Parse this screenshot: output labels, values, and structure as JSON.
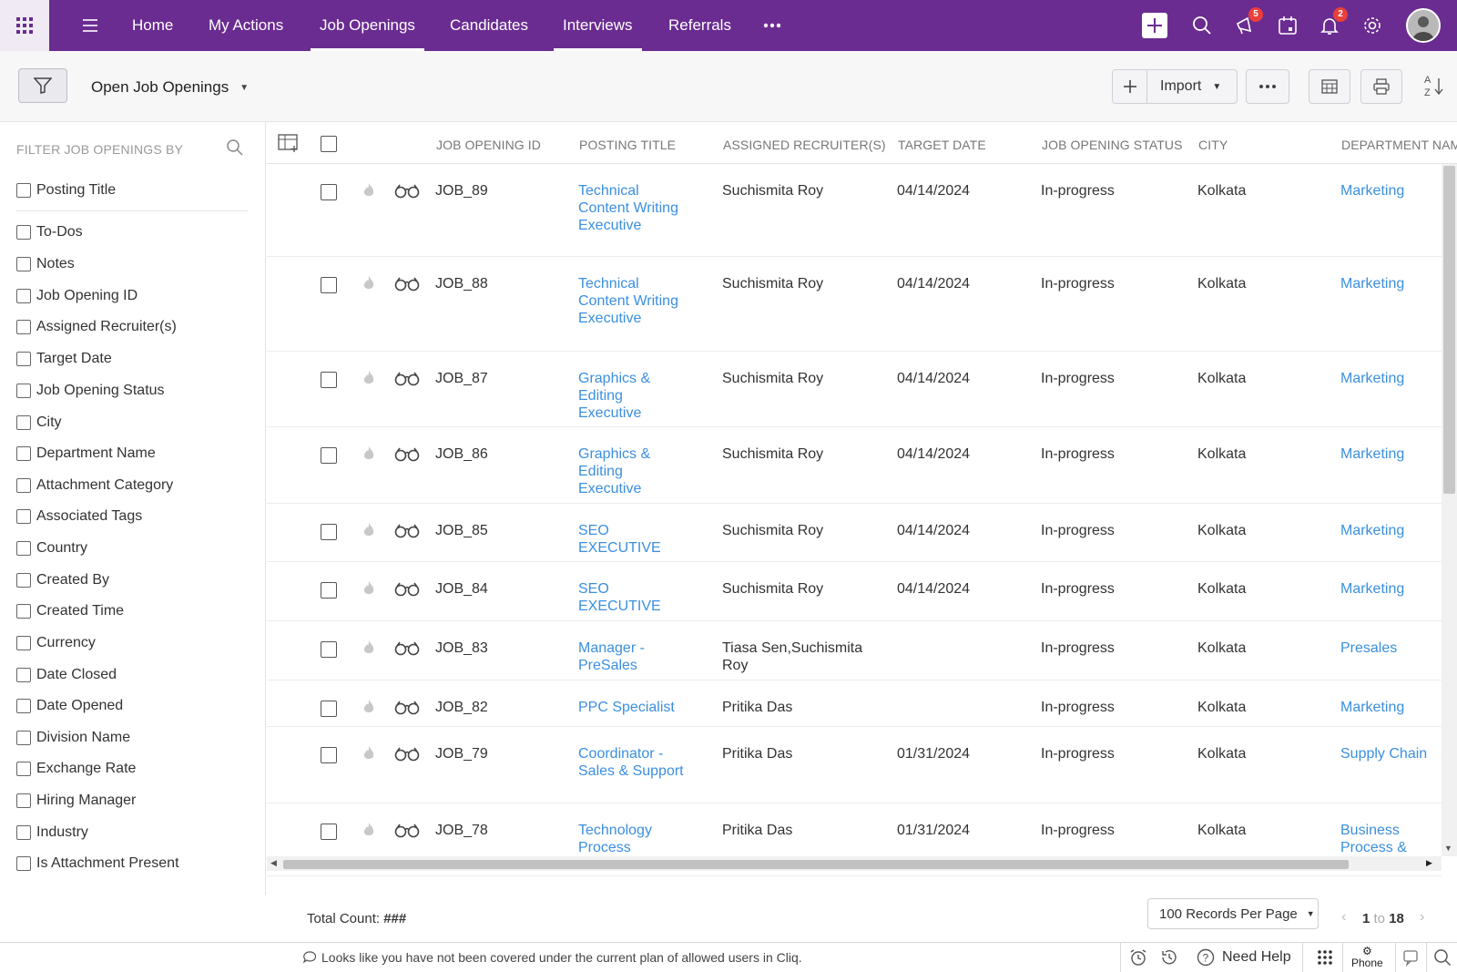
{
  "topnav": {
    "items": [
      "Home",
      "My Actions",
      "Job Openings",
      "Candidates",
      "Interviews",
      "Referrals"
    ],
    "active": [
      "Job Openings",
      "Interviews"
    ],
    "more_icon": "more-horizontal-icon",
    "badges": {
      "announcements": "5",
      "notifications": "2"
    },
    "accent_color": "#6a2c91"
  },
  "subbar": {
    "view_name": "Open Job Openings",
    "import_label": "Import"
  },
  "sidebar": {
    "header": "FILTER JOB OPENINGS BY",
    "filters": [
      "Posting Title",
      "To-Dos",
      "Notes",
      "Job Opening ID",
      "Assigned Recruiter(s)",
      "Target Date",
      "Job Opening Status",
      "City",
      "Department Name",
      "Attachment Category",
      "Associated Tags",
      "Country",
      "Created By",
      "Created Time",
      "Currency",
      "Date Closed",
      "Date Opened",
      "Division Name",
      "Exchange Rate",
      "Hiring Manager",
      "Industry",
      "Is Attachment Present"
    ]
  },
  "table": {
    "columns": [
      "JOB OPENING ID",
      "POSTING TITLE",
      "ASSIGNED RECRUITER(S)",
      "TARGET DATE",
      "JOB OPENING STATUS",
      "CITY",
      "DEPARTMENT NAM"
    ],
    "rows": [
      {
        "id": "JOB_89",
        "title": "Technical Content Writing Executive",
        "recruiter": "Suchismita Roy",
        "date": "04/14/2024",
        "status": "In-progress",
        "city": "Kolkata",
        "dept": "Marketing"
      },
      {
        "id": "JOB_88",
        "title": "Technical Content Writing Executive",
        "recruiter": "Suchismita Roy",
        "date": "04/14/2024",
        "status": "In-progress",
        "city": "Kolkata",
        "dept": "Marketing"
      },
      {
        "id": "JOB_87",
        "title": "Graphics & Editing Executive",
        "recruiter": "Suchismita Roy",
        "date": "04/14/2024",
        "status": "In-progress",
        "city": "Kolkata",
        "dept": "Marketing"
      },
      {
        "id": "JOB_86",
        "title": "Graphics & Editing Executive",
        "recruiter": "Suchismita Roy",
        "date": "04/14/2024",
        "status": "In-progress",
        "city": "Kolkata",
        "dept": "Marketing"
      },
      {
        "id": "JOB_85",
        "title": "SEO EXECUTIVE",
        "recruiter": "Suchismita Roy",
        "date": "04/14/2024",
        "status": "In-progress",
        "city": "Kolkata",
        "dept": "Marketing"
      },
      {
        "id": "JOB_84",
        "title": "SEO EXECUTIVE",
        "recruiter": "Suchismita Roy",
        "date": "04/14/2024",
        "status": "In-progress",
        "city": "Kolkata",
        "dept": "Marketing"
      },
      {
        "id": "JOB_83",
        "title": "Manager - PreSales",
        "recruiter": "Tiasa Sen,Suchismita Roy",
        "date": "",
        "status": "In-progress",
        "city": "Kolkata",
        "dept": "Presales"
      },
      {
        "id": "JOB_82",
        "title": "PPC Specialist",
        "recruiter": "Pritika Das",
        "date": "",
        "status": "In-progress",
        "city": "Kolkata",
        "dept": "Marketing"
      },
      {
        "id": "JOB_79",
        "title": "Coordinator - Sales & Support",
        "recruiter": "Pritika Das",
        "date": "01/31/2024",
        "status": "In-progress",
        "city": "Kolkata",
        "dept": "Supply Chain"
      },
      {
        "id": "JOB_78",
        "title": "Technology Process",
        "recruiter": "Pritika Das",
        "date": "01/31/2024",
        "status": "In-progress",
        "city": "Kolkata",
        "dept": "Business Process &"
      }
    ]
  },
  "footer": {
    "total_label": "Total Count:",
    "total_value": "###",
    "per_page": "100 Records Per Page",
    "page_from": "1",
    "page_to_word": "to",
    "page_to": "18"
  },
  "statusbar": {
    "message": "Looks like you have not been covered under the current plan of allowed users in Cliq.",
    "help": "Need Help",
    "phone": "Phone"
  }
}
